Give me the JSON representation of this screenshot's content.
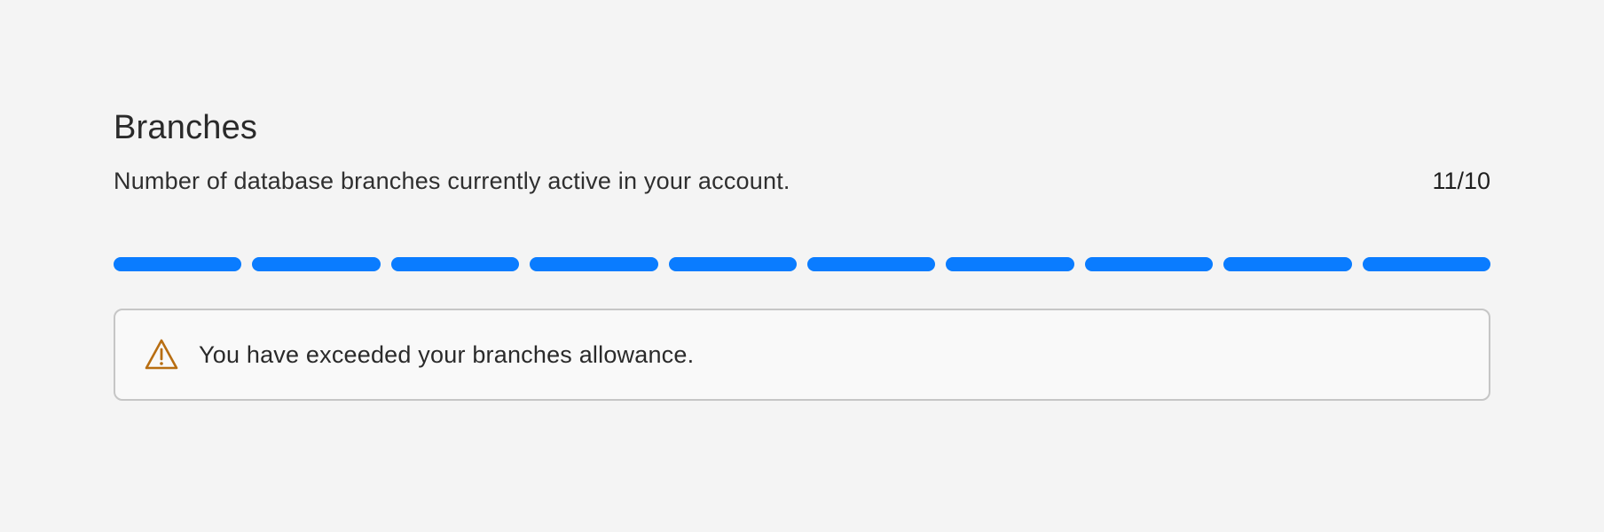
{
  "branches": {
    "title": "Branches",
    "description": "Number of database branches currently active in your account.",
    "usage_text": "11/10",
    "used": 11,
    "limit": 10,
    "meter_color": "#0a7cff",
    "alert": {
      "icon": "warning-triangle-icon",
      "icon_color": "#b86e12",
      "message": "You have exceeded your branches allowance."
    }
  }
}
